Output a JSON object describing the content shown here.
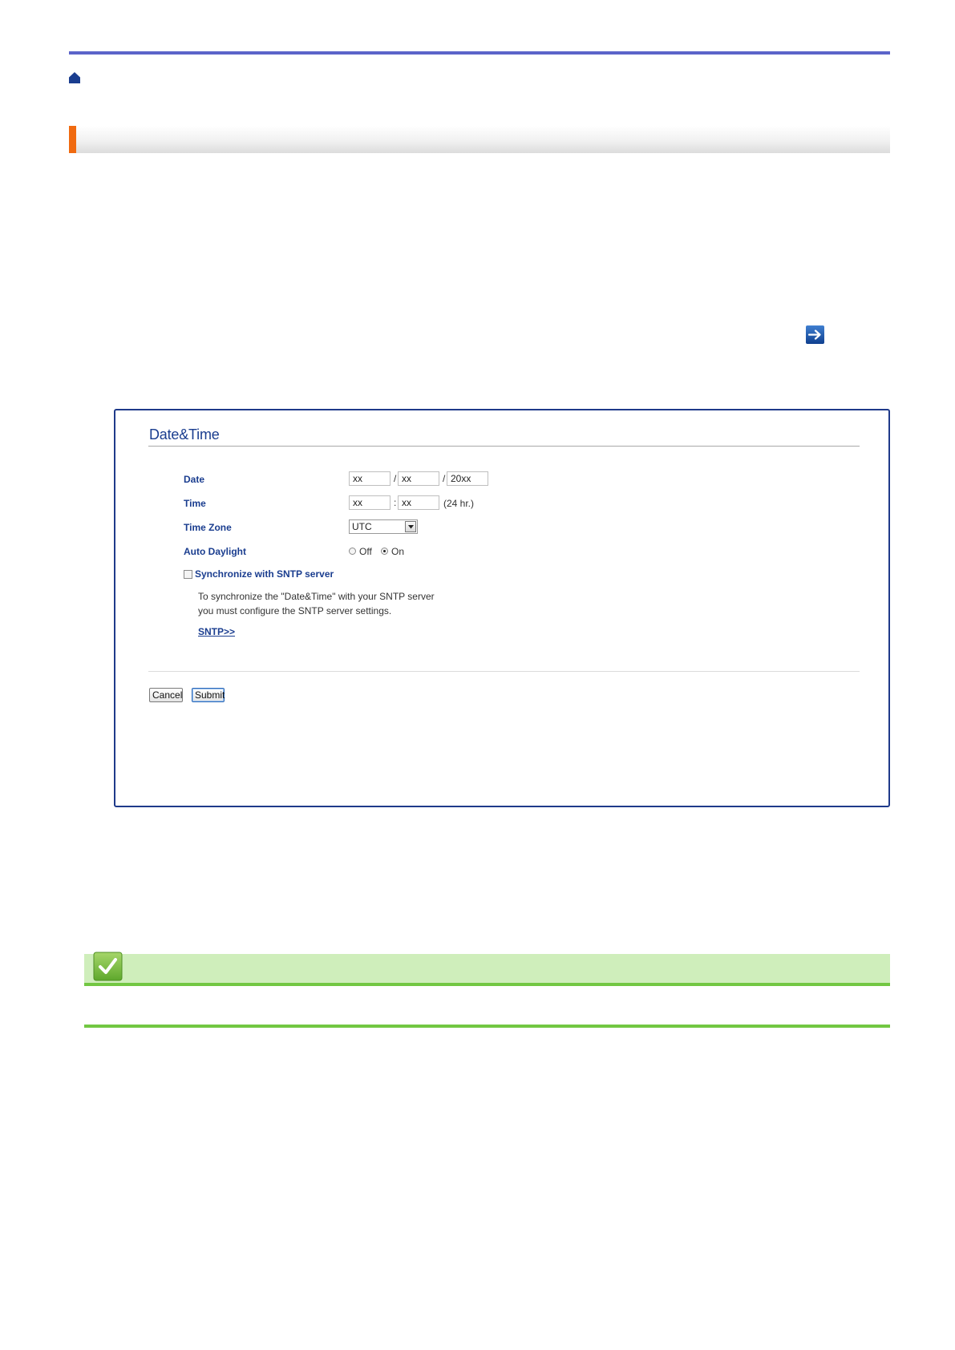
{
  "panel": {
    "title": "Date&Time",
    "rows": {
      "date_label": "Date",
      "date_month": "xx",
      "date_day": "xx",
      "date_year": "20xx",
      "date_sep": "/",
      "time_label": "Time",
      "time_hour": "xx",
      "time_minute": "xx",
      "time_sep": ":",
      "time_hint": "(24 hr.)",
      "zone_label": "Time Zone",
      "zone_value": "UTC",
      "daylight_label": "Auto Daylight",
      "daylight_off": "Off",
      "daylight_on": "On",
      "daylight_selected": "On"
    },
    "sync": {
      "label": "Synchronize with SNTP server",
      "checked": false,
      "note_line1": "To synchronize the \"Date&Time\" with your SNTP server",
      "note_line2": "you must configure the SNTP server settings.",
      "link": "SNTP>>"
    },
    "buttons": {
      "cancel": "Cancel",
      "submit": "Submit"
    }
  },
  "colors": {
    "top_rule": "#5b64c9",
    "section_accent": "#f06a10",
    "panel_border": "#1f3a8a",
    "label_blue": "#1a3d8f",
    "note_green": "#72c742",
    "note_bg": "#cfeebb"
  },
  "icons": {
    "home": "home-icon",
    "arrow": "arrow-right-icon",
    "check": "checkmark-icon"
  }
}
